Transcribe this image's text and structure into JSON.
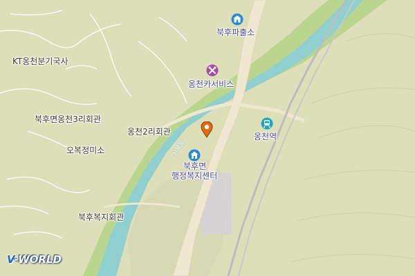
{
  "map": {
    "labels": {
      "police_box": "북후파출소",
      "car_service": "옹천카서비스",
      "kt_building": "KT옹천분기국사",
      "village_hall_3": "북후면옹천3리회관",
      "village_hall_2": "옹천2리회관",
      "beauty_salon": "오복정미소",
      "welfare_hall": "북후복지회관",
      "admin_center_line1": "북후면",
      "admin_center_line2": "행정복지센터",
      "station": "옹천역",
      "road_name": "신북로"
    },
    "icons": {
      "police_box": "police-station-icon",
      "car_service": "car-repair-icon",
      "admin_center": "government-office-icon",
      "station": "train-station-icon",
      "marker": "location-pin-icon"
    },
    "colors": {
      "land": "#dcdfb8",
      "river": "#8fcfd0",
      "river_bank": "#a9cf7a",
      "road": "#f2ead6",
      "poi_blue": "#2a88d8",
      "poi_purple": "#a64ca6",
      "marker": "#e26a12"
    }
  },
  "brand": {
    "logo_prefix": "V",
    "logo_text": "-WORLD"
  }
}
